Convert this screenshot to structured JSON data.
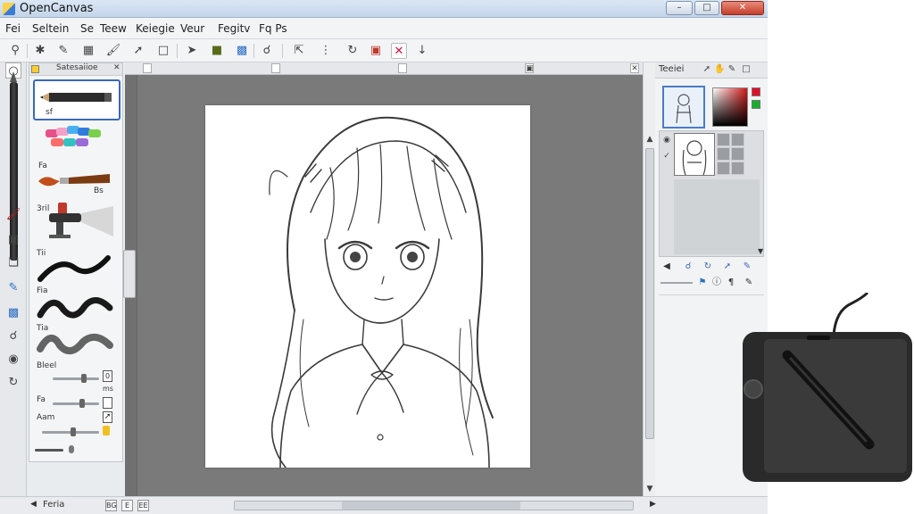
{
  "window": {
    "title": "OpenCanvas",
    "minimize_glyph": "–",
    "maximize_glyph": "□",
    "close_glyph": "✕"
  },
  "menu": {
    "items": [
      "Fei",
      "Seltein",
      "Se",
      "Teew",
      "Keiegie",
      "Veur",
      "Fegitv",
      "Fq Ps"
    ]
  },
  "toolbar": {
    "icons": [
      "search-icon",
      "lasso-icon",
      "pen-icon",
      "bucket-icon",
      "brush-icon",
      "move-icon",
      "frame-icon",
      "select-icon",
      "layer-icon",
      "layers-stack-icon",
      "zoom-icon",
      "transform-icon",
      "dots-icon",
      "rotate-icon",
      "filter-icon",
      "delete-icon",
      "save-icon"
    ]
  },
  "brush_panel": {
    "title": "Satesaiioe",
    "close_glyph": "✕",
    "brush_labels": [
      "sf",
      "Fa",
      "Bs",
      "3ril",
      "Tii",
      "Fia",
      "Tia"
    ],
    "sliders": [
      {
        "label": "Bleel",
        "value": "0",
        "unit": "ms",
        "position": 0.62
      },
      {
        "label": "Fa",
        "value": "",
        "unit": "",
        "position": 0.6
      },
      {
        "label": "Aam",
        "value": "",
        "unit": "",
        "position": 0.5
      }
    ]
  },
  "status": {
    "label": "Feria",
    "buttons": [
      "BG",
      "E",
      "EE"
    ]
  },
  "right_panel": {
    "title": "Teeiei",
    "colors": {
      "primary": "#e0102a",
      "secondary": "#17b02e"
    }
  },
  "accent_color": "#3a68b5"
}
